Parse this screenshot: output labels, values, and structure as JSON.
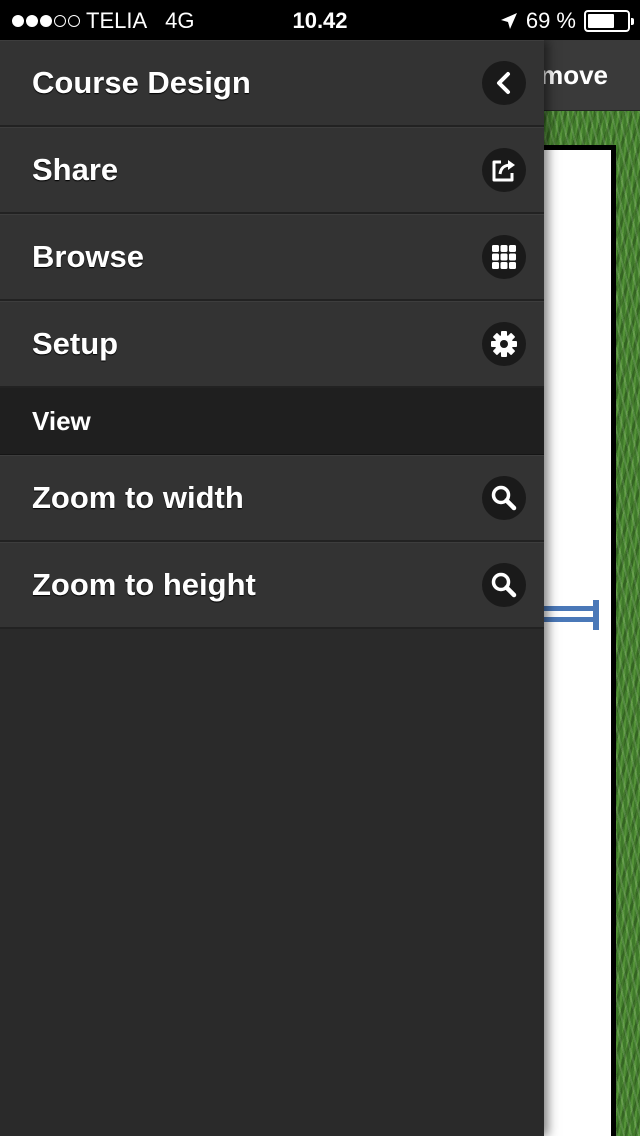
{
  "status_bar": {
    "signal_dots_filled": 3,
    "signal_dots_total": 5,
    "carrier": "TELIA",
    "network": "4G",
    "time": "10.42",
    "battery_text": "69 %",
    "battery_level": 0.69,
    "icons": [
      "location-arrow-icon",
      "battery-icon"
    ]
  },
  "background": {
    "toolbar_button": "move"
  },
  "drawer": {
    "items": [
      {
        "label": "Course Design",
        "icon": "chevron-left-icon"
      },
      {
        "label": "Share",
        "icon": "share-icon"
      },
      {
        "label": "Browse",
        "icon": "grid-icon"
      },
      {
        "label": "Setup",
        "icon": "gear-icon"
      }
    ],
    "section": {
      "label": "View"
    },
    "view_items": [
      {
        "label": "Zoom to width",
        "icon": "search-icon"
      },
      {
        "label": "Zoom to height",
        "icon": "search-icon"
      }
    ]
  },
  "colors": {
    "drawer_bg": "#2a2a2a",
    "item_bg": "#333333",
    "section_bg": "#1f1f1f",
    "grass": "#3f7a2a",
    "course_mark": "#4a78b8"
  }
}
